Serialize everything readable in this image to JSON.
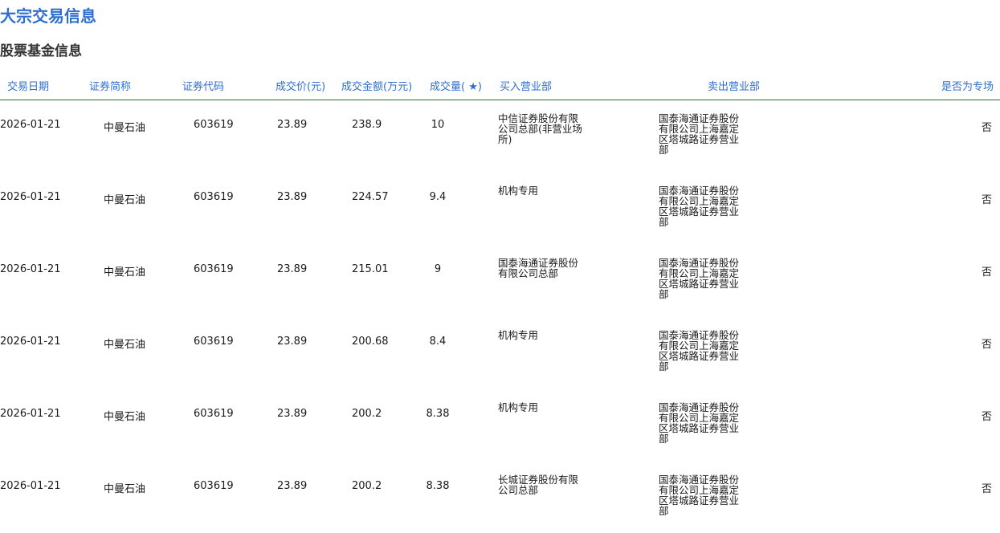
{
  "page": {
    "title": "大宗交易信息",
    "section_title": "股票基金信息"
  },
  "table": {
    "headers": [
      "交易日期",
      "证券简称",
      "证券代码",
      "成交价(元)",
      "成交金额(万元)",
      "成交量( ★)",
      "买入营业部",
      "卖出营业部",
      "是否为专场"
    ],
    "rows": [
      {
        "date": "2026-01-21",
        "name": "中曼石油",
        "code": "603619",
        "price": "23.89",
        "amount": "238.9",
        "volume": "10",
        "buyer": "中信证券股份有限公司总部(非营业场所)",
        "seller": "国泰海通证券股份有限公司上海嘉定区塔城路证券营业部",
        "special": "否"
      },
      {
        "date": "2026-01-21",
        "name": "中曼石油",
        "code": "603619",
        "price": "23.89",
        "amount": "224.57",
        "volume": "9.4",
        "buyer": "机构专用",
        "seller": "国泰海通证券股份有限公司上海嘉定区塔城路证券营业部",
        "special": "否"
      },
      {
        "date": "2026-01-21",
        "name": "中曼石油",
        "code": "603619",
        "price": "23.89",
        "amount": "215.01",
        "volume": "9",
        "buyer": "国泰海通证券股份有限公司总部",
        "seller": "国泰海通证券股份有限公司上海嘉定区塔城路证券营业部",
        "special": "否"
      },
      {
        "date": "2026-01-21",
        "name": "中曼石油",
        "code": "603619",
        "price": "23.89",
        "amount": "200.68",
        "volume": "8.4",
        "buyer": "机构专用",
        "seller": "国泰海通证券股份有限公司上海嘉定区塔城路证券营业部",
        "special": "否"
      },
      {
        "date": "2026-01-21",
        "name": "中曼石油",
        "code": "603619",
        "price": "23.89",
        "amount": "200.2",
        "volume": "8.38",
        "buyer": "机构专用",
        "seller": "国泰海通证券股份有限公司上海嘉定区塔城路证券营业部",
        "special": "否"
      },
      {
        "date": "2026-01-21",
        "name": "中曼石油",
        "code": "603619",
        "price": "23.89",
        "amount": "200.2",
        "volume": "8.38",
        "buyer": "长城证券股份有限公司总部",
        "seller": "国泰海通证券股份有限公司上海嘉定区塔城路证券营业部",
        "special": "否"
      }
    ]
  },
  "colors": {
    "accent": "#2f6fd0",
    "divider": "#2e6b3c",
    "text": "#1a1a1a"
  }
}
